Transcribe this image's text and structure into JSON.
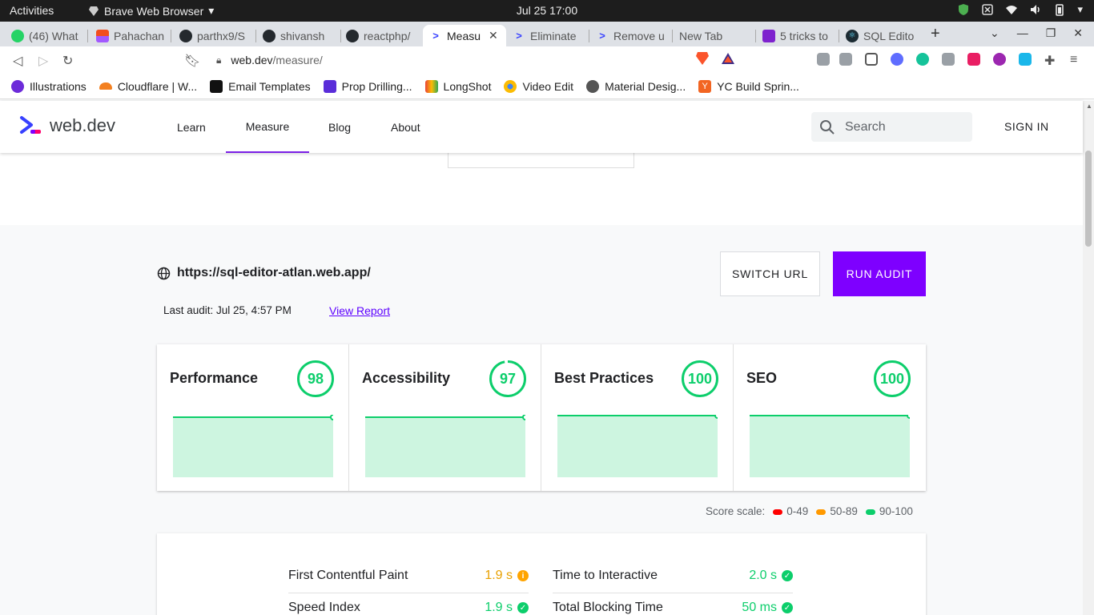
{
  "system": {
    "activities": "Activities",
    "app_name": "Brave Web Browser",
    "clock": "Jul 25  17:00"
  },
  "tabs": [
    {
      "label": "(46) What",
      "color": "#25d366",
      "fav": "46"
    },
    {
      "label": "Pahachan",
      "color": "#f24e1e",
      "fav": ""
    },
    {
      "label": "parthx9/S",
      "color": "#24292e",
      "fav": ""
    },
    {
      "label": "shivansh",
      "color": "#24292e",
      "fav": ""
    },
    {
      "label": "reactphp/",
      "color": "#24292e",
      "fav": ""
    },
    {
      "label": "Measu",
      "color": "#3740ff",
      "fav": ""
    },
    {
      "label": "Eliminate",
      "color": "#3740ff",
      "fav": ""
    },
    {
      "label": "Remove u",
      "color": "#3740ff",
      "fav": ""
    },
    {
      "label": "New Tab",
      "color": "",
      "fav": ""
    },
    {
      "label": "5 tricks to",
      "color": "#7e22ce",
      "fav": ""
    },
    {
      "label": "SQL Edito",
      "color": "#1c2b33",
      "fav": ""
    }
  ],
  "address": {
    "host": "web.dev",
    "path": "/measure/"
  },
  "bookmarks": [
    {
      "label": "Illustrations",
      "color": "#6c2bd9"
    },
    {
      "label": "Cloudflare | W...",
      "color": "#f38020"
    },
    {
      "label": "Email Templates",
      "color": "#111111"
    },
    {
      "label": "Prop Drilling...",
      "color": "#5a2dd9"
    },
    {
      "label": "LongShot",
      "color": "#ea4335"
    },
    {
      "label": "Video Edit",
      "color": "#4285f4"
    },
    {
      "label": "Material Desig...",
      "color": "#555555"
    },
    {
      "label": "YC Build Sprin...",
      "color": "#f26522"
    }
  ],
  "site": {
    "logo": "web.dev",
    "nav": [
      "Learn",
      "Measure",
      "Blog",
      "About"
    ],
    "search_placeholder": "Search",
    "signin": "SIGN IN"
  },
  "audit": {
    "url": "https://sql-editor-atlan.web.app/",
    "switch_url": "SWITCH URL",
    "run_audit": "RUN AUDIT",
    "last_audit": "Last audit: Jul 25, 4:57 PM",
    "view_report": "View Report"
  },
  "scores": [
    {
      "title": "Performance",
      "score": "98",
      "value": 98
    },
    {
      "title": "Accessibility",
      "score": "97",
      "value": 97
    },
    {
      "title": "Best Practices",
      "score": "100",
      "value": 100
    },
    {
      "title": "SEO",
      "score": "100",
      "value": 100
    }
  ],
  "score_scale": {
    "label": "Score scale:",
    "ranges": [
      {
        "label": "0-49",
        "color": "#ff0000"
      },
      {
        "label": "50-89",
        "color": "#ff9900"
      },
      {
        "label": "90-100",
        "color": "#0cce6b"
      }
    ]
  },
  "metrics": [
    {
      "label": "First Contentful Paint",
      "value": "1.9 s",
      "status": "average",
      "color": "#ffa400"
    },
    {
      "label": "Time to Interactive",
      "value": "2.0 s",
      "status": "pass",
      "color": "#0cce6b"
    },
    {
      "label": "Speed Index",
      "value": "1.9 s",
      "status": "pass",
      "color": "#0cce6b"
    },
    {
      "label": "Total Blocking Time",
      "value": "50 ms",
      "status": "pass",
      "color": "#0cce6b"
    }
  ],
  "colors": {
    "accent": "#7e00ff",
    "pass": "#0cce6b",
    "spark_fill": "#cdf5e0"
  }
}
